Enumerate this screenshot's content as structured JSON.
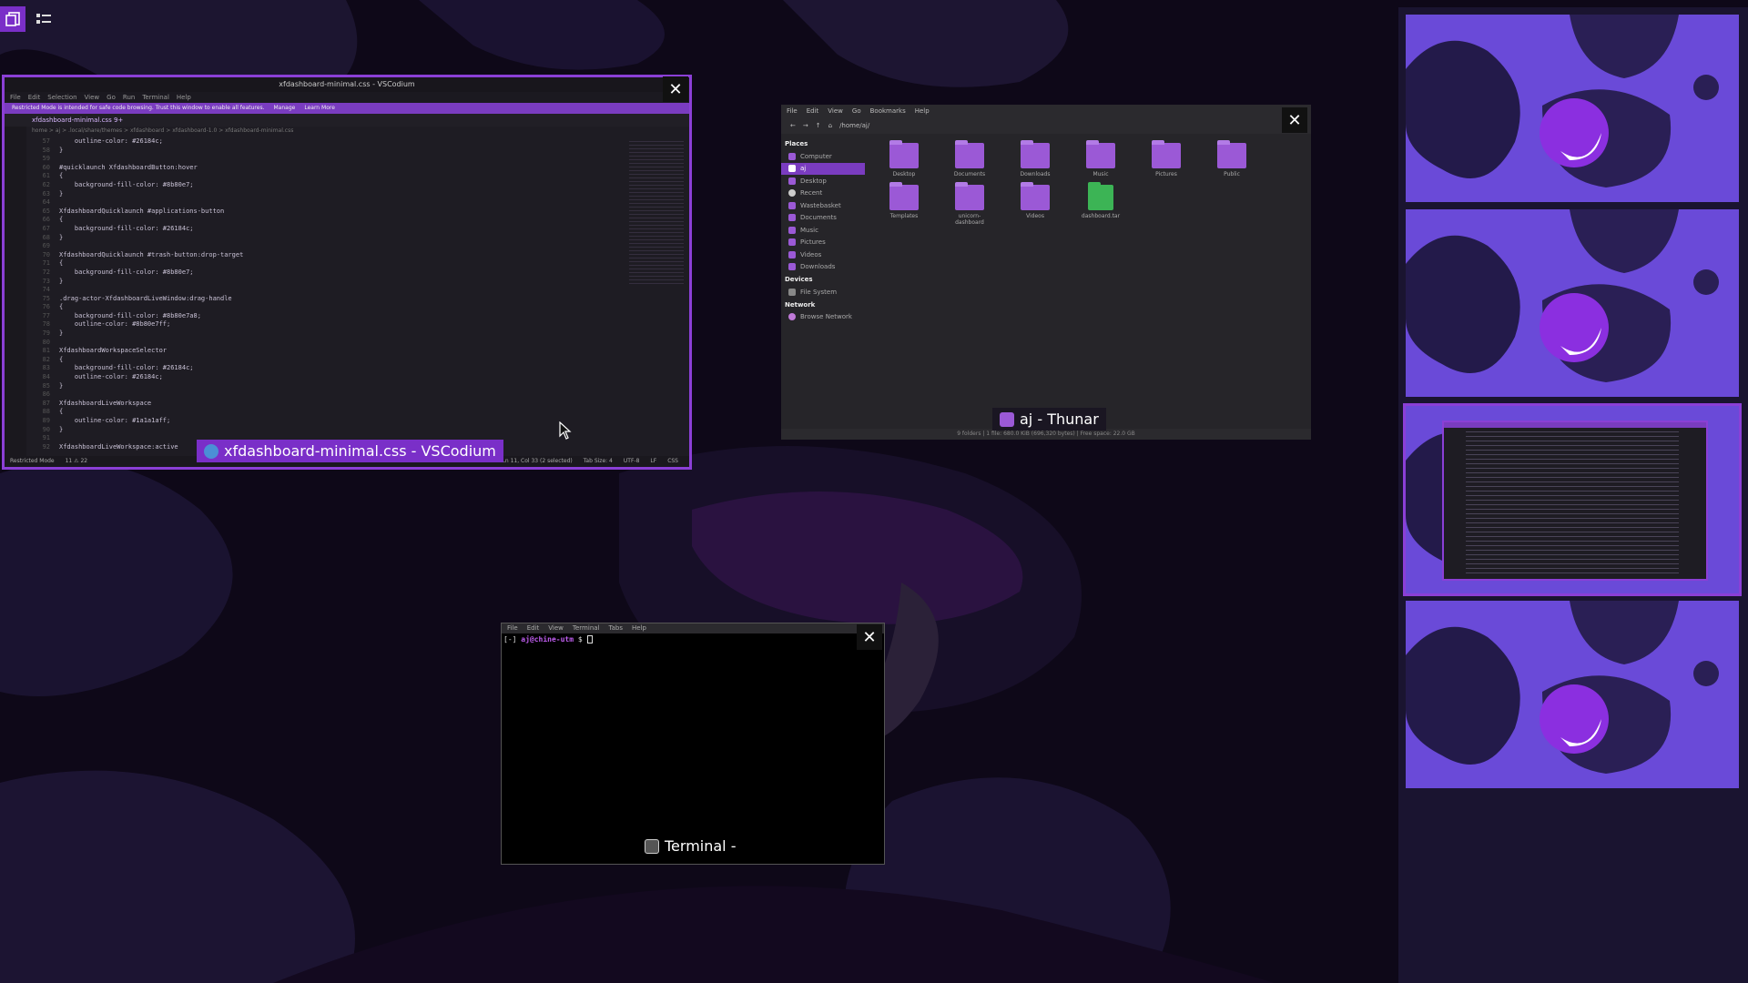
{
  "colors": {
    "accent": "#7a2fc8",
    "wallpaper": "#0e0818",
    "panel": "#1a1430"
  },
  "topbar": {
    "windows_icon": "windows-view-icon",
    "apps_icon": "apps-view-icon"
  },
  "vscode": {
    "title": "xfdashboard-minimal.css - VSCodium",
    "menu": [
      "File",
      "Edit",
      "Selection",
      "View",
      "Go",
      "Run",
      "Terminal",
      "Help"
    ],
    "banner": "Restricted Mode is intended for safe code browsing. Trust this window to enable all features.",
    "banner_manage": "Manage",
    "banner_learn": "Learn More",
    "tab": "xfdashboard-minimal.css 9+",
    "breadcrumb": "home > aj > .local/share/themes > xfdashboard > xfdashboard-1.0 > xfdashboard-minimal.css",
    "code": [
      {
        "n": "57",
        "t": "    outline-color: #26184c;"
      },
      {
        "n": "58",
        "t": "}"
      },
      {
        "n": "59",
        "t": ""
      },
      {
        "n": "60",
        "t": "#quicklaunch XfdashboardButton:hover"
      },
      {
        "n": "61",
        "t": "{"
      },
      {
        "n": "62",
        "t": "    background-fill-color: #8b80e7;"
      },
      {
        "n": "63",
        "t": "}"
      },
      {
        "n": "64",
        "t": ""
      },
      {
        "n": "65",
        "t": "XfdashboardQuicklaunch #applications-button"
      },
      {
        "n": "66",
        "t": "{"
      },
      {
        "n": "67",
        "t": "    background-fill-color: #26184c;"
      },
      {
        "n": "68",
        "t": "}"
      },
      {
        "n": "69",
        "t": ""
      },
      {
        "n": "70",
        "t": "XfdashboardQuicklaunch #trash-button:drop-target"
      },
      {
        "n": "71",
        "t": "{"
      },
      {
        "n": "72",
        "t": "    background-fill-color: #8b80e7;"
      },
      {
        "n": "73",
        "t": "}"
      },
      {
        "n": "74",
        "t": ""
      },
      {
        "n": "75",
        "t": ".drag-actor-XfdashboardLiveWindow:drag-handle"
      },
      {
        "n": "76",
        "t": "{"
      },
      {
        "n": "77",
        "t": "    background-fill-color: #8b80e7a8;"
      },
      {
        "n": "78",
        "t": "    outline-color: #8b80e7ff;"
      },
      {
        "n": "79",
        "t": "}"
      },
      {
        "n": "80",
        "t": ""
      },
      {
        "n": "81",
        "t": "XfdashboardWorkspaceSelector"
      },
      {
        "n": "82",
        "t": "{"
      },
      {
        "n": "83",
        "t": "    background-fill-color: #26184c;"
      },
      {
        "n": "84",
        "t": "    outline-color: #26184c;"
      },
      {
        "n": "85",
        "t": "}"
      },
      {
        "n": "86",
        "t": ""
      },
      {
        "n": "87",
        "t": "XfdashboardLiveWorkspace"
      },
      {
        "n": "88",
        "t": "{"
      },
      {
        "n": "89",
        "t": "    outline-color: #1a1a1aff;"
      },
      {
        "n": "90",
        "t": "}"
      },
      {
        "n": "91",
        "t": ""
      },
      {
        "n": "92",
        "t": "XfdashboardLiveWorkspace:active"
      }
    ],
    "status_mode": "Restricted Mode",
    "status_problems": "11 ⚠ 22",
    "status_pos": "Ln 11, Col 33 (2 selected)",
    "status_tab": "Tab Size: 4",
    "status_enc": "UTF-8",
    "status_eol": "LF",
    "status_lang": "CSS",
    "caption": "xfdashboard-minimal.css - VSCodium"
  },
  "thunar": {
    "menu": [
      "File",
      "Edit",
      "View",
      "Go",
      "Bookmarks",
      "Help"
    ],
    "path": "/home/aj/",
    "places_header": "Places",
    "places": [
      "Computer",
      "aj",
      "Desktop",
      "Recent",
      "Wastebasket",
      "Documents",
      "Music",
      "Pictures",
      "Videos",
      "Downloads"
    ],
    "devices_header": "Devices",
    "devices": [
      "File System"
    ],
    "network_header": "Network",
    "network": [
      "Browse Network"
    ],
    "files": [
      "Desktop",
      "Documents",
      "Downloads",
      "Music",
      "Pictures",
      "Public",
      "Templates",
      "unicorn-dashboard",
      "Videos",
      "dashboard.tar"
    ],
    "status": "9 folders  |  1 file: 680.0 KiB (696,320 bytes)  |  Free space: 22.0 GB",
    "caption": "aj - Thunar"
  },
  "terminal": {
    "menu": [
      "File",
      "Edit",
      "View",
      "Terminal",
      "Tabs",
      "Help"
    ],
    "prompt_prefix": "[-] ",
    "prompt_user": "aj@chine-utm",
    "prompt_suffix": " $ ",
    "caption": "Terminal -"
  },
  "workspaces": {
    "count": 4,
    "active_index": 2
  }
}
